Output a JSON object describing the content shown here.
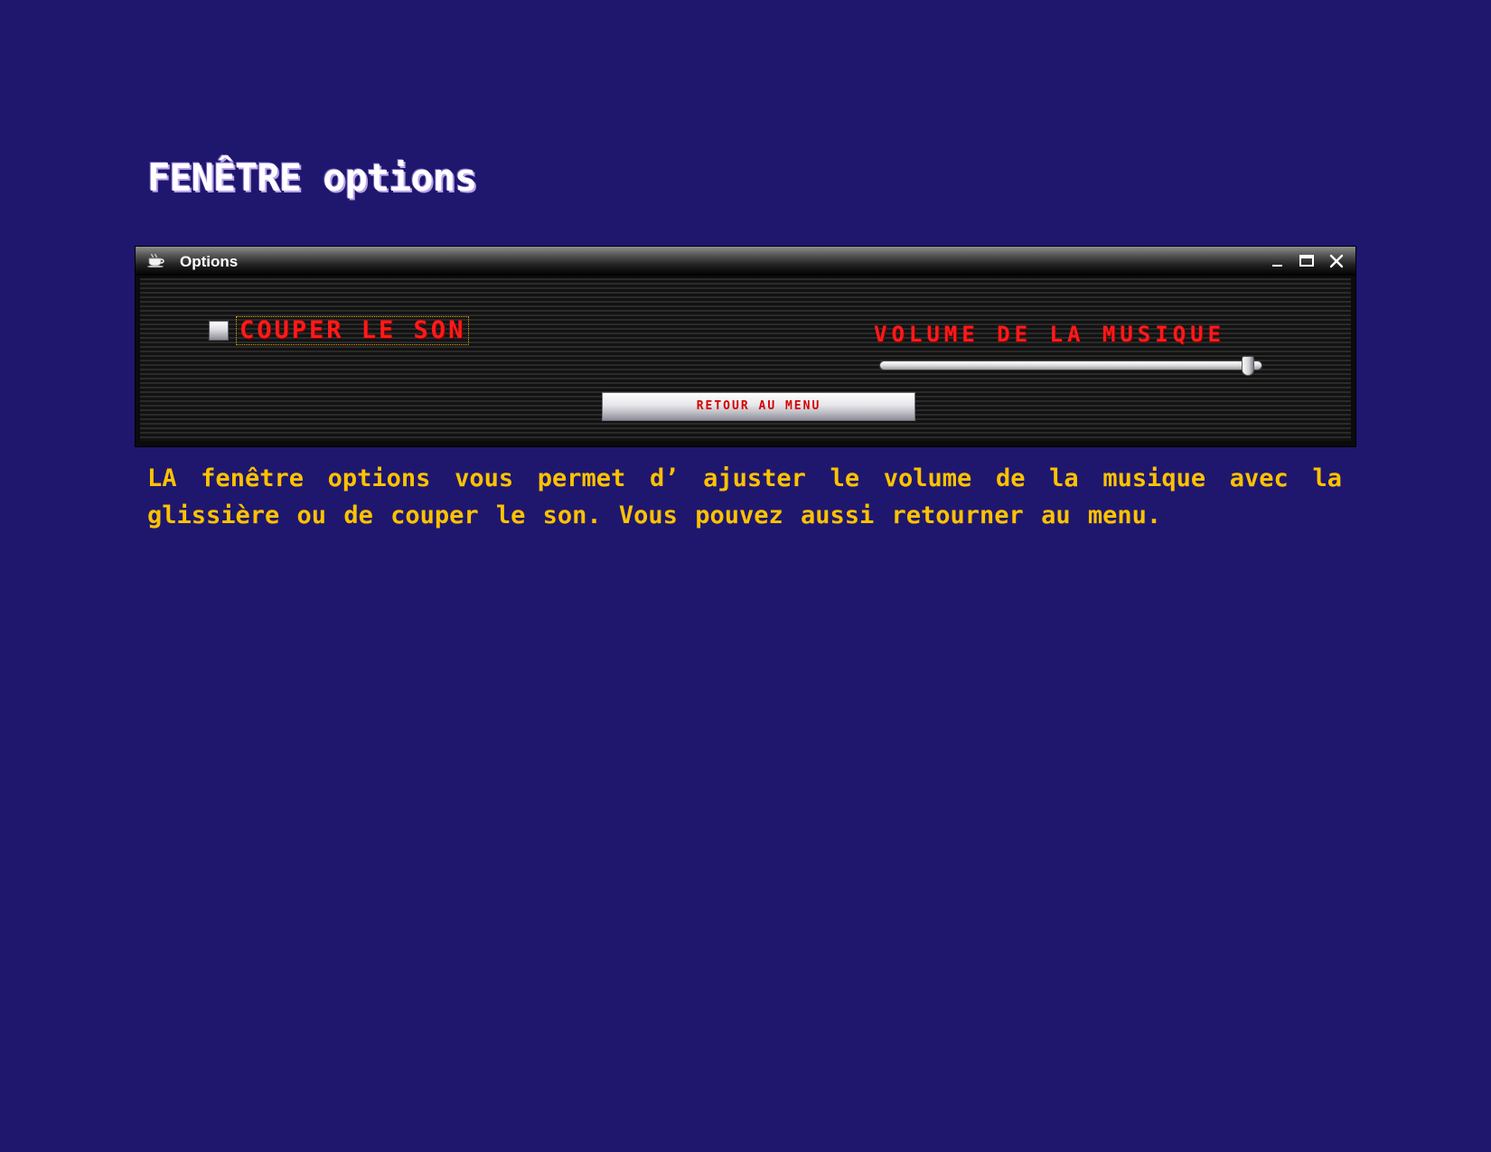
{
  "page": {
    "title": "FENÊTRE options",
    "background_color": "#1f176e"
  },
  "window": {
    "title": "Options",
    "icon": "coffee-cup-icon",
    "controls": {
      "minimize_icon": "minimize-icon",
      "maximize_icon": "maximize-icon",
      "close_icon": "close-icon"
    }
  },
  "options": {
    "mute_checkbox": {
      "label": "COUPER LE SON",
      "checked": false
    },
    "volume": {
      "label": "VOLUME DE LA MUSIQUE",
      "level": 0.98
    },
    "menu_button": {
      "label": "RETOUR AU MENU"
    }
  },
  "description": "LA fenêtre options vous permet d’ ajuster le volume de la musique avec la glissière ou de couper le son. Vous pouvez aussi retourner au menu.",
  "colors": {
    "label_red": "#ff1a1a",
    "description_yellow": "#ffc200",
    "title_white": "#ffffff"
  }
}
